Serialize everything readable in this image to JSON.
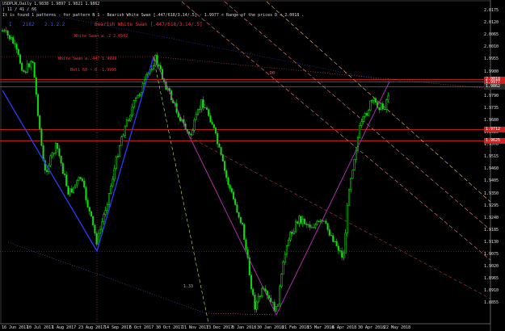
{
  "header": {
    "symbol_line": "USDPLN,Daily  1.9838 1.9897 1.9821 1.9862",
    "timer_line": "| 11 / 41 / 66",
    "pattern_line": "It is found 1 patterns  - for pattern N 1 - Bearish White Swan [.447/618/3.14/.5] - 1.9977 < Range of the prices D < 2.0018 ."
  },
  "annotations": {
    "blue_labels": [
      "I",
      "2182",
      "2.1.2.2"
    ],
    "pattern_title": "Bearish White Swan [.447/618/3.14/.5]",
    "white_swan_b": "White Swan a..2 2.0502",
    "white_swan_c": "White Swan a..447 1.9999",
    "bull_60": "Bull 60 ~ 0 -1.9995",
    "zone_label": "D0",
    "fib_label": "1.33"
  },
  "price_axis": {
    "labels": [
      "2.0175",
      "2.0120",
      "2.0065",
      "2.0010",
      "1.9955",
      "1.9900",
      "1.9845",
      "1.9790",
      "1.9735",
      "1.9680",
      "1.9625",
      "1.9570",
      "1.9515",
      "1.9460",
      "1.9405",
      "1.9350",
      "1.9295",
      "1.9240",
      "1.9185",
      "1.9130",
      "1.9075",
      "1.9020",
      "1.8965",
      "1.8910",
      "1.8855"
    ],
    "tags": [
      {
        "text": "2.0018",
        "color": "#d02020"
      },
      {
        "text": "1.9977",
        "color": "#d02020"
      },
      {
        "text": "1.9862",
        "color": "#2a2a2a"
      },
      {
        "text": "1.9712",
        "color": "#d02020"
      },
      {
        "text": "1.9625",
        "color": "#d02020"
      }
    ]
  },
  "time_axis": {
    "labels": [
      "16 Jun 2017",
      "10 Jul 2017",
      "1 Aug 2017",
      "23 Aug 2017",
      "14 Sep 2017",
      "6 Oct 2017",
      "30 Oct 2017",
      "21 Nov 2017",
      "13 Dec 2017",
      "8 Jan 2018",
      "30 Jan 2018",
      "21 Feb 2018",
      "15 Mar 2018",
      "6 Apr 2018",
      "30 Apr 2018",
      "22 May 2018"
    ]
  },
  "colors": {
    "background": "#000000",
    "bull_candle": "#00ff00",
    "bear_candle": "#00cc00",
    "horizontal_levels": "#ff2020",
    "xabcd_leg1": "#2a3cff",
    "xabcd_leg2": "#c030c0",
    "channel": "#ff7070"
  }
}
